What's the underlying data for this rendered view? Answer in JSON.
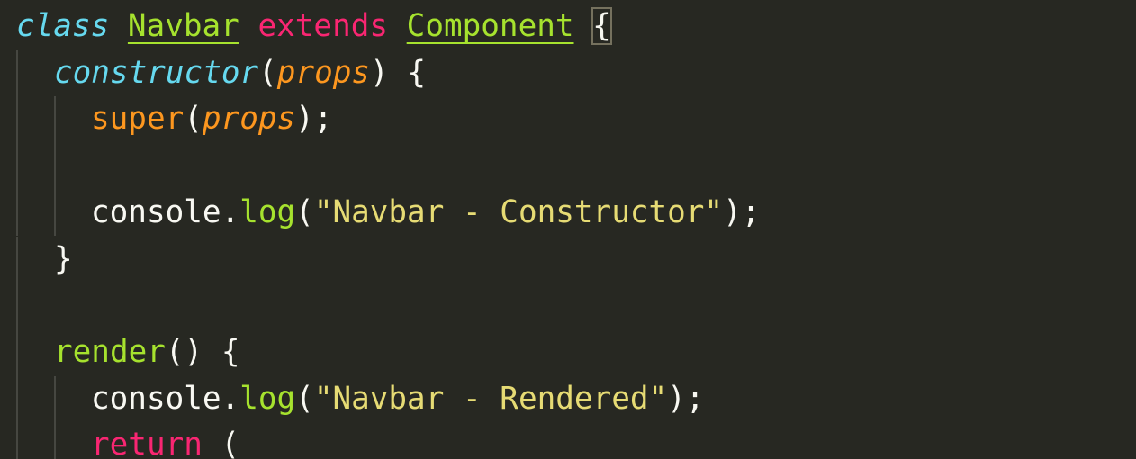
{
  "editor": {
    "theme_colors": {
      "background": "#272822",
      "keyword": "#f92672",
      "storage": "#66d9ef",
      "function": "#a6e22e",
      "parameter": "#fd971f",
      "string": "#e6db74",
      "text": "#f8f8f2",
      "indent_guide": "#464741"
    },
    "lines": [
      {
        "tokens": [
          {
            "text": "class",
            "type": "storage"
          },
          {
            "text": " ",
            "type": "punct"
          },
          {
            "text": "Navbar",
            "type": "cls"
          },
          {
            "text": " ",
            "type": "punct"
          },
          {
            "text": "extends",
            "type": "kw"
          },
          {
            "text": " ",
            "type": "punct"
          },
          {
            "text": "Component",
            "type": "cls"
          },
          {
            "text": " ",
            "type": "punct"
          },
          {
            "text": "{",
            "type": "bracket"
          }
        ]
      },
      {
        "tokens": [
          {
            "text": "constructor",
            "type": "storage"
          },
          {
            "text": "(",
            "type": "punct"
          },
          {
            "text": "props",
            "type": "param"
          },
          {
            "text": ") {",
            "type": "punct"
          }
        ]
      },
      {
        "tokens": [
          {
            "text": "super",
            "type": "builtin"
          },
          {
            "text": "(",
            "type": "punct"
          },
          {
            "text": "props",
            "type": "param"
          },
          {
            "text": ");",
            "type": "punct"
          }
        ]
      },
      {
        "tokens": []
      },
      {
        "tokens": [
          {
            "text": "console.",
            "type": "punct"
          },
          {
            "text": "log",
            "type": "fn"
          },
          {
            "text": "(",
            "type": "punct"
          },
          {
            "text": "\"Navbar - Constructor\"",
            "type": "str"
          },
          {
            "text": ");",
            "type": "punct"
          }
        ]
      },
      {
        "tokens": [
          {
            "text": "}",
            "type": "punct"
          }
        ]
      },
      {
        "tokens": []
      },
      {
        "tokens": [
          {
            "text": "render",
            "type": "fn"
          },
          {
            "text": "() {",
            "type": "punct"
          }
        ]
      },
      {
        "tokens": [
          {
            "text": "console.",
            "type": "punct"
          },
          {
            "text": "log",
            "type": "fn"
          },
          {
            "text": "(",
            "type": "punct"
          },
          {
            "text": "\"Navbar - Rendered\"",
            "type": "str"
          },
          {
            "text": ");",
            "type": "punct"
          }
        ]
      },
      {
        "tokens": [
          {
            "text": "return",
            "type": "kw"
          },
          {
            "text": " (",
            "type": "punct"
          }
        ]
      }
    ]
  }
}
